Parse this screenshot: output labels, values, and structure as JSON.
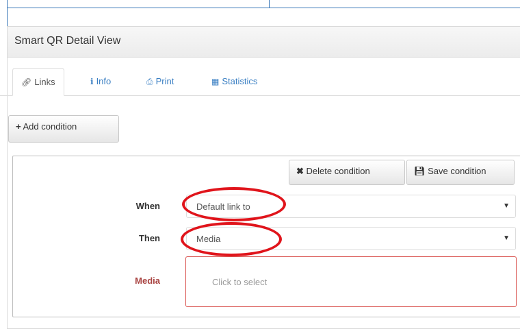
{
  "panel": {
    "title": "Smart QR Detail View"
  },
  "tabs": [
    {
      "label": "Links",
      "icon": "link-icon",
      "active": true
    },
    {
      "label": "Info",
      "icon": "info-icon",
      "active": false
    },
    {
      "label": "Print",
      "icon": "print-icon",
      "active": false
    },
    {
      "label": "Statistics",
      "icon": "chart-icon",
      "active": false
    }
  ],
  "toolbar": {
    "add_condition_label": "Add condition"
  },
  "condition": {
    "delete_label": "Delete condition",
    "save_label": "Save condition",
    "when_label": "When",
    "when_value": "Default link to",
    "then_label": "Then",
    "then_value": "Media",
    "media_label": "Media",
    "media_placeholder": "Click to select"
  },
  "colors": {
    "accent": "#3a7fc3",
    "highlight": "#e0141b",
    "error": "#a94442"
  }
}
